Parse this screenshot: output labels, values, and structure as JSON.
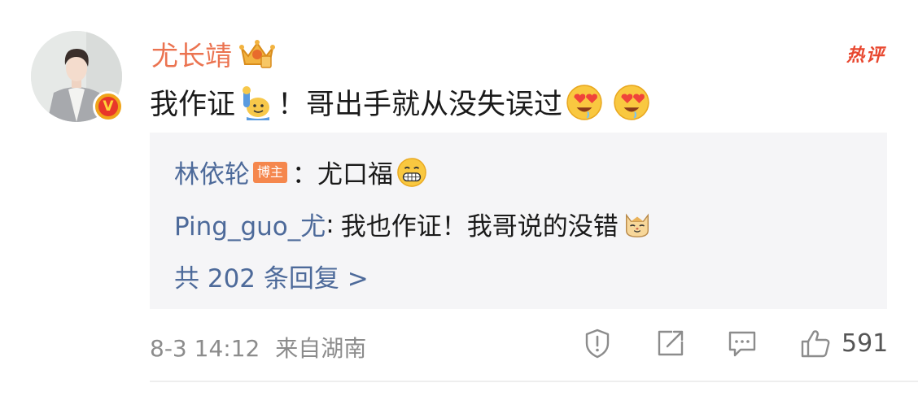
{
  "comment": {
    "username": "尤长靖",
    "hot_tag": "热评",
    "text_before": "我作证",
    "text_middle": "！哥出手就从没失误过",
    "icons": [
      "crown-icon",
      "raising-hand-emoji",
      "heart-eyes-emoji",
      "grin-emoji",
      "cat-emoji",
      "verified-v-icon"
    ]
  },
  "replies": [
    {
      "author": "林依轮",
      "tag": "博主",
      "separator": "：",
      "body": "尤口福"
    },
    {
      "author": "Ping_guo_尤",
      "separator": ":",
      "body": "我也作证！我哥说的没错"
    }
  ],
  "more_replies": "共 202 条回复 >",
  "footer": {
    "timestamp": "8-3 14:12",
    "location": "来自湖南",
    "like_count": "591"
  },
  "colors": {
    "username": "#eb7350",
    "link_blue": "#4d6a9a",
    "hot_red": "#e8472f",
    "reply_bg": "#f5f5f7"
  }
}
